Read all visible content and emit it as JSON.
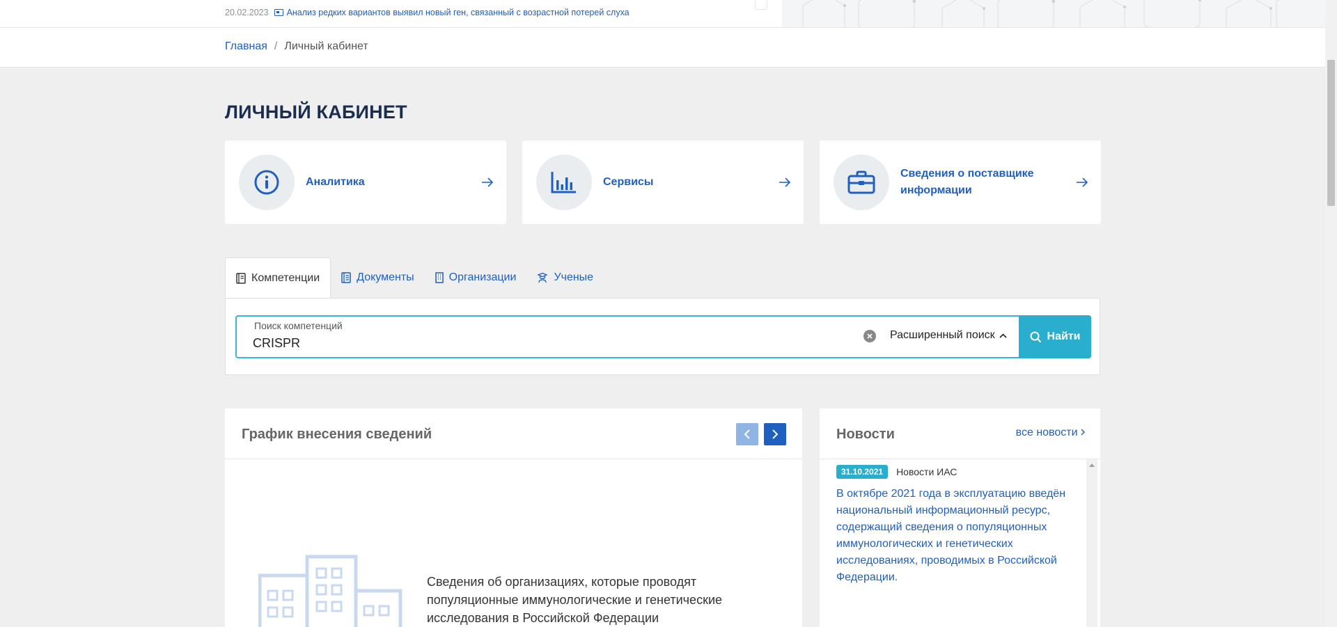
{
  "top_strip": {
    "news_date": "20.02.2023",
    "news_icon": "newspaper-icon",
    "news_text": "Анализ редких вариантов выявил новый ген, связанный с возрастной потерей слуха"
  },
  "breadcrumb": {
    "home": "Главная",
    "separator": "/",
    "current": "Личный кабинет"
  },
  "page_title": "ЛИЧНЫЙ КАБИНЕТ",
  "cards": [
    {
      "label": "Аналитика",
      "icon": "info-icon"
    },
    {
      "label": "Сервисы",
      "icon": "bar-chart-icon"
    },
    {
      "label": "Сведения о поставщике информации",
      "icon": "briefcase-icon"
    }
  ],
  "tabs": [
    {
      "label": "Компетенции",
      "icon": "book-icon",
      "active": true
    },
    {
      "label": "Документы",
      "icon": "document-icon",
      "active": false
    },
    {
      "label": "Организации",
      "icon": "building-icon",
      "active": false
    },
    {
      "label": "Ученые",
      "icon": "scientist-icon",
      "active": false
    }
  ],
  "search": {
    "label": "Поиск компетенций",
    "value": "CRISPR",
    "advanced_label": "Расширенный поиск",
    "find_label": "Найти"
  },
  "chart_panel": {
    "title": "График внесения сведений",
    "description": "Сведения об организациях, которые проводят популяционные иммунологические и генетические исследования в Российской Федерации"
  },
  "news_panel": {
    "title": "Новости",
    "all_news_label": "все новости",
    "items": [
      {
        "date": "31.10.2021",
        "source": "Новости ИАС",
        "text": "В октябре 2021 года в эксплуатацию введён национальный информационный ресурс, содержащий сведения о популяционных иммунологических и генетических исследованиях, проводимых в Российской Федерации."
      }
    ]
  },
  "colors": {
    "accent_blue": "#1f5fbf",
    "teal": "#29aecd",
    "title_navy": "#1b2d4e",
    "background": "#efefef"
  }
}
